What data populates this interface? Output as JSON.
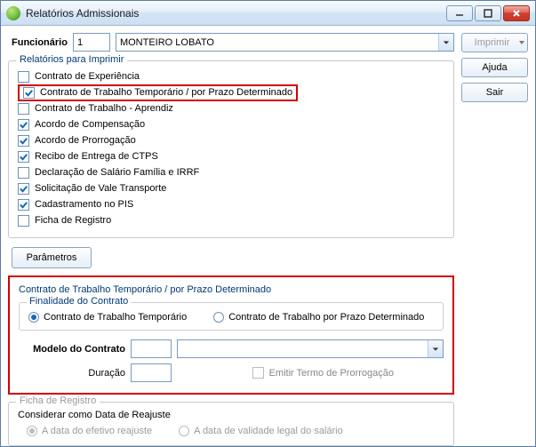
{
  "title": "Relatórios Admissionais",
  "side": {
    "imprimir": "Imprimir",
    "ajuda": "Ajuda",
    "sair": "Sair"
  },
  "func": {
    "label": "Funcionário",
    "num": "1",
    "name": "MONTEIRO LOBATO"
  },
  "reports": {
    "legend": "Relatórios para Imprimir",
    "items": [
      {
        "label": "Contrato de Experiência",
        "checked": false,
        "hl": false
      },
      {
        "label": "Contrato de Trabalho Temporário / por Prazo Determinado",
        "checked": true,
        "hl": true
      },
      {
        "label": "Contrato de Trabalho - Aprendiz",
        "checked": false,
        "hl": false
      },
      {
        "label": "Acordo de Compensação",
        "checked": true,
        "hl": false
      },
      {
        "label": "Acordo de Prorrogação",
        "checked": true,
        "hl": false
      },
      {
        "label": "Recibo de Entrega de CTPS",
        "checked": true,
        "hl": false
      },
      {
        "label": "Declaração de Salário Família e IRRF",
        "checked": false,
        "hl": false
      },
      {
        "label": "Solicitação de Vale Transporte",
        "checked": true,
        "hl": false
      },
      {
        "label": "Cadastramento no PIS",
        "checked": true,
        "hl": false
      },
      {
        "label": "Ficha de Registro",
        "checked": false,
        "hl": false
      }
    ]
  },
  "parametros": "Parâmetros",
  "contrato": {
    "title": "Contrato de Trabalho Temporário / por Prazo Determinado",
    "finalidade_legend": "Finalidade do Contrato",
    "opt_temp": "Contrato de Trabalho Temporário",
    "opt_prazo": "Contrato de Trabalho por Prazo Determinado",
    "modelo_label": "Modelo do Contrato",
    "modelo_num": "",
    "modelo_desc": "",
    "duracao_label": "Duração",
    "duracao_val": "",
    "emitir_termo": "Emitir Termo de Prorrogação"
  },
  "ficha": {
    "legend": "Ficha de Registro",
    "consider": "Considerar como Data de Reajuste",
    "opt_efetivo": "A data do efetivo reajuste",
    "opt_validade": "A data de validade legal do salário"
  }
}
